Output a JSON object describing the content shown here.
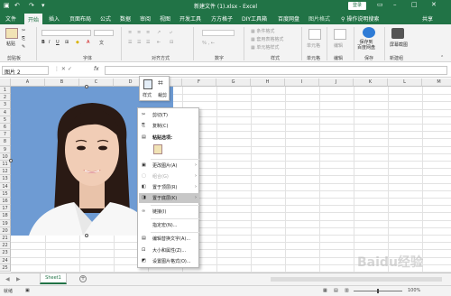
{
  "titlebar": {
    "title": "新建文件 (1).xlsx  -  Excel",
    "login": "登录",
    "save_icon": "save-icon",
    "undo_icon": "undo-icon",
    "redo_icon": "redo-icon"
  },
  "tabs": [
    "文件",
    "开始",
    "插入",
    "页面布局",
    "公式",
    "数据",
    "审阅",
    "视图",
    "开发工具",
    "方方格子",
    "DIY工具箱",
    "百度网盘",
    "图片格式"
  ],
  "tellme": "操作说明搜索",
  "share": "共享",
  "ribbon": {
    "groups": [
      "剪贴板",
      "字体",
      "对齐方式",
      "数字",
      "样式",
      "单元格",
      "编辑",
      "保存",
      "新建组"
    ],
    "paste": "粘贴",
    "cond_format": "条件格式",
    "table_format": "套用表格格式",
    "cell_styles": "单元格样式",
    "cells": "单元格",
    "editing": "编辑",
    "save_baidu": "保存到\n百度网盘",
    "screenshot": "屏幕截图"
  },
  "formula_bar": {
    "name_box": "图片 2",
    "fx": "fx"
  },
  "columns": [
    "A",
    "B",
    "C",
    "D",
    "E",
    "F",
    "G",
    "H",
    "I",
    "J",
    "K",
    "L",
    "M"
  ],
  "rows": [
    "1",
    "2",
    "3",
    "4",
    "5",
    "6",
    "7",
    "8",
    "9",
    "10",
    "11",
    "12",
    "13",
    "14",
    "15",
    "16",
    "17",
    "18",
    "19",
    "20",
    "21",
    "22",
    "23",
    "24",
    "25"
  ],
  "mini_toolbar": {
    "style": "样式",
    "crop": "裁剪"
  },
  "context_menu": [
    {
      "label": "剪切(T)",
      "icon": "scissors-icon",
      "disabled": false
    },
    {
      "label": "复制(C)",
      "icon": "copy-icon",
      "disabled": false
    },
    {
      "label": "粘贴选项:",
      "icon": "paste-icon",
      "disabled": false,
      "bold": true
    },
    {
      "label": "",
      "icon": "clipboard-icon",
      "disabled": false
    },
    {
      "label": "更改图片(A)",
      "icon": "change-picture-icon",
      "disabled": false,
      "submenu": true
    },
    {
      "label": "组合(G)",
      "icon": "group-icon",
      "disabled": true,
      "submenu": true
    },
    {
      "label": "置于顶层(R)",
      "icon": "bring-front-icon",
      "disabled": false,
      "submenu": true
    },
    {
      "label": "置于底层(K)",
      "icon": "send-back-icon",
      "disabled": false,
      "submenu": true,
      "highlight": true
    },
    {
      "label": "链接(I)",
      "icon": "link-icon",
      "disabled": false
    },
    {
      "label": "指定宏(N)...",
      "icon": "",
      "disabled": false
    },
    {
      "label": "编辑替换文字(A)...",
      "icon": "alt-text-icon",
      "disabled": false
    },
    {
      "label": "大小和属性(Z)...",
      "icon": "size-icon",
      "disabled": false
    },
    {
      "label": "设置图片格式(O)...",
      "icon": "format-picture-icon",
      "disabled": false
    }
  ],
  "sheet": {
    "tab": "Sheet1"
  },
  "status": {
    "mode": "就绪",
    "zoom": "100%"
  },
  "colors": {
    "excel_green": "#217346",
    "photo_bg": "#6e9bd3",
    "highlight": "#c7c7c7"
  },
  "watermark": "Baidu经验"
}
